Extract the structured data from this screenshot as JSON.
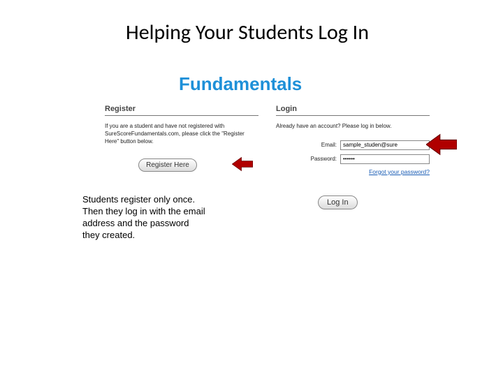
{
  "title": "Helping Your Students Log In",
  "brand": "Fundamentals",
  "register": {
    "heading": "Register",
    "blurb": "If you are a student and have not registered with SureScoreFundamentals.com, please click the \"Register Here\" button below.",
    "button": "Register Here"
  },
  "login": {
    "heading": "Login",
    "blurb": "Already have an account? Please log in below.",
    "email_label": "Email:",
    "email_value": "sample_studen@sure",
    "password_label": "Password:",
    "password_value": "••••••",
    "forgot": "Forgot your password?",
    "button": "Log In"
  },
  "note": "Students register only once.  Then they log in with the email address and the password they created."
}
